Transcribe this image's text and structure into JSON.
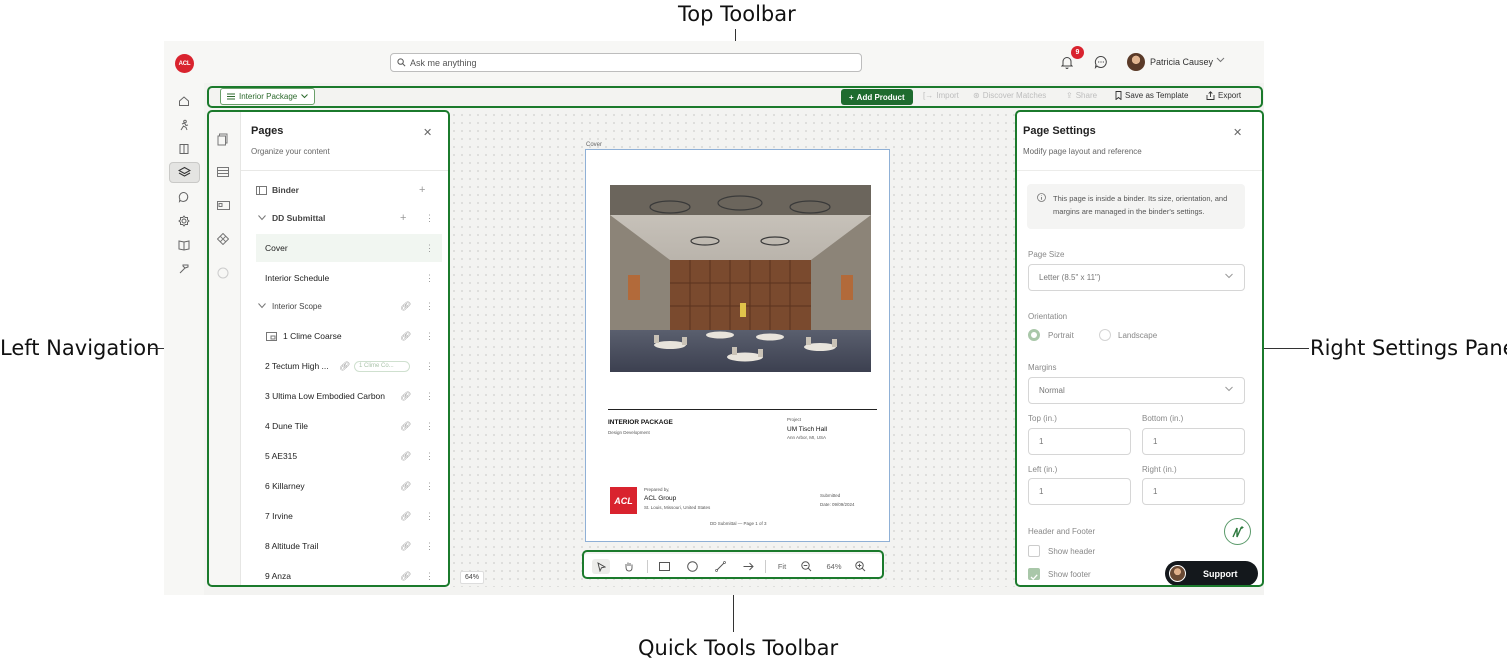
{
  "callouts": {
    "top_toolbar": "Top Toolbar",
    "left_navigation": "Left Navigation",
    "right_settings_panel": "Right Settings Panel",
    "quick_tools_toolbar": "Quick Tools Toolbar"
  },
  "header": {
    "logo_text": "ACL",
    "search_placeholder": "Ask me anything",
    "notification_count": "9",
    "user_name": "Patricia Causey"
  },
  "toolbar": {
    "package_label": "Interior Package",
    "add_product": "Add Product",
    "import": "Import",
    "discover_matches": "Discover Matches",
    "share": "Share",
    "save_as_template": "Save as Template",
    "export": "Export"
  },
  "pages_panel": {
    "title": "Pages",
    "subtitle": "Organize your content",
    "binder_label": "Binder",
    "section_label": "DD Submittal",
    "items": [
      {
        "label": "Cover"
      },
      {
        "label": "Interior Schedule"
      },
      {
        "label": "Interior Scope"
      },
      {
        "label": "1 Clime Coarse"
      },
      {
        "label": "2 Tectum High ..."
      },
      {
        "label": "3 Ultima Low Embodied Carbon"
      },
      {
        "label": "4 Dune Tile"
      },
      {
        "label": "5 AE315"
      },
      {
        "label": "6 Killarney"
      },
      {
        "label": "7 Irvine"
      },
      {
        "label": "8 Altitude Trail"
      },
      {
        "label": "9 Anza"
      }
    ],
    "linked_chip": "1 Clime Co..."
  },
  "canvas": {
    "page_label": "Cover",
    "zoom": "64%",
    "document": {
      "title": "INTERIOR PACKAGE",
      "phase": "Design Development",
      "project_label": "Project",
      "project_name": "UM Tisch Hall",
      "project_location": "Ann Arbor, MI, USA",
      "prepared_by_label": "Prepared by,",
      "company": "ACL Group",
      "company_location": "St. Louis, Missouri, United States",
      "submitted_label": "Submitted",
      "submitted_date": "Date: 09/09/2024",
      "footer": "DD Submittal — Page 1 of 3",
      "logo_text": "ACL"
    }
  },
  "quick_tools": {
    "fit": "Fit",
    "zoom": "64%"
  },
  "settings_panel": {
    "title": "Page Settings",
    "subtitle": "Modify page layout and reference",
    "info": "This page is inside a binder. Its size, orientation, and margins are managed in the binder's settings.",
    "page_size_label": "Page Size",
    "page_size_value": "Letter (8.5\" x 11\")",
    "orientation_label": "Orientation",
    "orientation_options": [
      "Portrait",
      "Landscape"
    ],
    "orientation_selected": "Portrait",
    "margins_label": "Margins",
    "margins_value": "Normal",
    "top_label": "Top (in.)",
    "top_value": "1",
    "bottom_label": "Bottom (in.)",
    "bottom_value": "1",
    "left_label": "Left (in.)",
    "left_value": "1",
    "right_label": "Right (in.)",
    "right_value": "1",
    "header_footer_label": "Header and Footer",
    "show_header": "Show header",
    "show_footer": "Show footer",
    "show_header_checked": false,
    "show_footer_checked": true,
    "support_label": "Support"
  },
  "colors": {
    "highlight": "#1b7a2c",
    "primary_button": "#1e6b2e",
    "brand_red": "#d9232e"
  }
}
